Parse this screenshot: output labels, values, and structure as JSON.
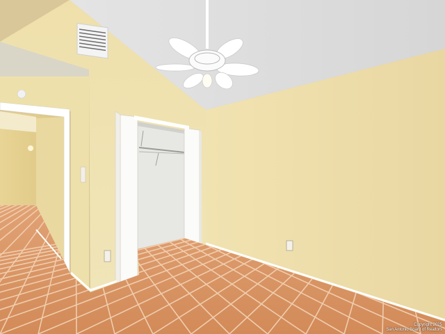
{
  "photo": {
    "subject": "Empty bedroom with vaulted textured ceiling, ceiling fan, open bifold closet and terracotta tile floor",
    "colors": {
      "wall_right": "#f0e3b0",
      "wall_left": "#efe2ad",
      "ceiling": "#e2e2e2",
      "floor": "#d9925f",
      "grout": "#f1cfae",
      "trim": "#ffffff",
      "closet_interior": "#e6e6e6",
      "hallway": "#ead99c"
    }
  },
  "watermark": {
    "line1": "Copyright 2025",
    "line2": "San Antonio Board of Realtors"
  }
}
